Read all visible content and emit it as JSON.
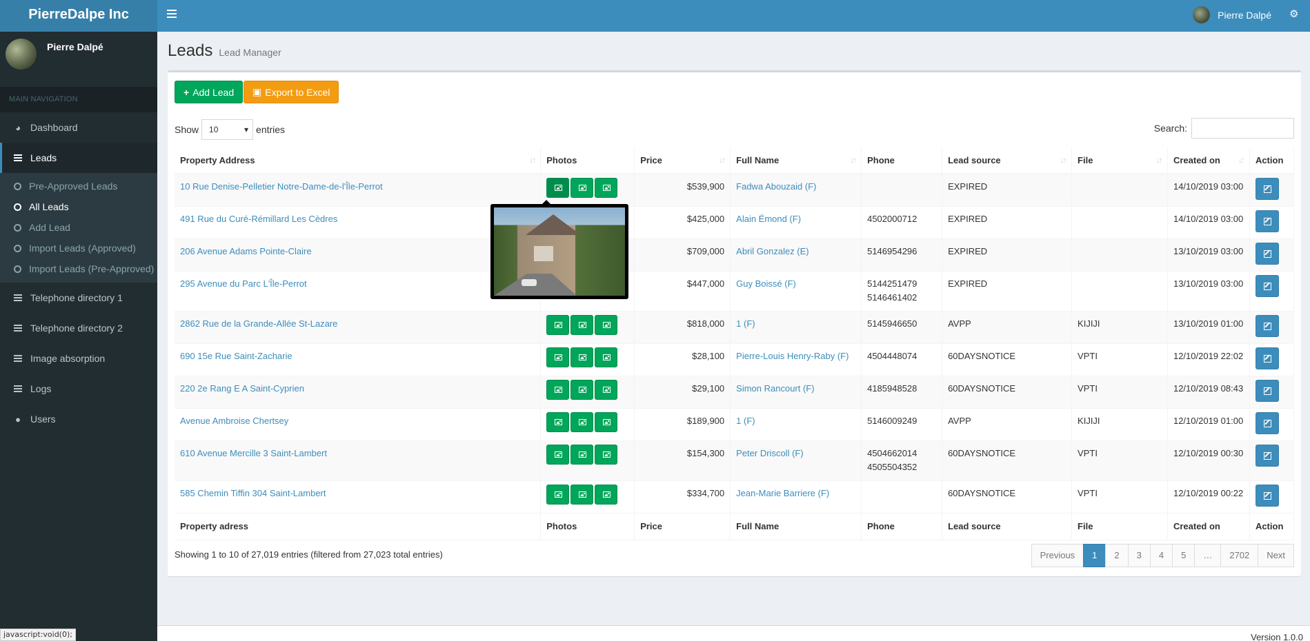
{
  "brand": "PierreDalpe Inc",
  "topbar": {
    "user_name": "Pierre Dalpé"
  },
  "sidebar": {
    "user_name": "Pierre Dalpé",
    "nav_header": "MAIN NAVIGATION",
    "items": [
      {
        "label": "Dashboard",
        "icon": "dashboard-icon"
      },
      {
        "label": "Leads",
        "icon": "menu-icon"
      },
      {
        "label": "Telephone directory 1",
        "icon": "menu-icon"
      },
      {
        "label": "Telephone directory 2",
        "icon": "menu-icon"
      },
      {
        "label": "Image absorption",
        "icon": "menu-icon"
      },
      {
        "label": "Logs",
        "icon": "menu-icon"
      },
      {
        "label": "Users",
        "icon": "user-icon"
      }
    ],
    "leads_sub": [
      {
        "label": "Pre-Approved Leads"
      },
      {
        "label": "All Leads"
      },
      {
        "label": "Add Lead"
      },
      {
        "label": "Import Leads (Approved)"
      },
      {
        "label": "Import Leads (Pre-Approved)"
      }
    ]
  },
  "page": {
    "title": "Leads",
    "subtitle": "Lead Manager"
  },
  "toolbar": {
    "add_label": "Add Lead",
    "export_label": "Export to Excel"
  },
  "table_controls": {
    "show_label": "Show",
    "entries_value": "10",
    "entries_label": "entries",
    "search_label": "Search:"
  },
  "columns": [
    "Property Address",
    "Photos",
    "Price",
    "Full Name",
    "Phone",
    "Lead source",
    "File",
    "Created on",
    "Action"
  ],
  "footer_columns": [
    "Property adress",
    "Photos",
    "Price",
    "Full Name",
    "Phone",
    "Lead source",
    "File",
    "Created on",
    "Action"
  ],
  "rows": [
    {
      "address": "10 Rue Denise-Pelletier Notre-Dame-de-l'Île-Perrot",
      "price": "$539,900",
      "name": "Fadwa Abouzaid (F)",
      "phone1": "",
      "phone2": "",
      "source": "EXPIRED",
      "file": "",
      "created": "14/10/2019 03:00"
    },
    {
      "address": "491 Rue du Curé-Rémillard Les Cèdres",
      "price": "$425,000",
      "name": "Alain Émond (F)",
      "phone1": "4502000712",
      "phone2": "",
      "source": "EXPIRED",
      "file": "",
      "created": "14/10/2019 03:00"
    },
    {
      "address": "206 Avenue Adams Pointe-Claire",
      "price": "$709,000",
      "name": "Abril Gonzalez (E)",
      "phone1": "5146954296",
      "phone2": "",
      "source": "EXPIRED",
      "file": "",
      "created": "13/10/2019 03:00"
    },
    {
      "address": "295 Avenue du Parc L'Île-Perrot",
      "price": "$447,000",
      "name": "Guy Boissé (F)",
      "phone1": "5144251479",
      "phone2": "5146461402",
      "source": "EXPIRED",
      "file": "",
      "created": "13/10/2019 03:00"
    },
    {
      "address": "2862 Rue de la Grande-Allée St-Lazare",
      "price": "$818,000",
      "name": "1 (F)",
      "phone1": "5145946650",
      "phone2": "",
      "source": "AVPP",
      "file": "KIJIJI",
      "created": "13/10/2019 01:00"
    },
    {
      "address": "690 15e Rue Saint-Zacharie",
      "price": "$28,100",
      "name": "Pierre-Louis Henry-Raby (F)",
      "phone1": "4504448074",
      "phone2": "",
      "source": "60DAYSNOTICE",
      "file": "VPTI",
      "created": "12/10/2019 22:02"
    },
    {
      "address": "220 2e Rang E A Saint-Cyprien",
      "price": "$29,100",
      "name": "Simon Rancourt (F)",
      "phone1": "4185948528",
      "phone2": "",
      "source": "60DAYSNOTICE",
      "file": "VPTI",
      "created": "12/10/2019 08:43"
    },
    {
      "address": "Avenue Ambroise Chertsey",
      "price": "$189,900",
      "name": "1 (F)",
      "phone1": "5146009249",
      "phone2": "",
      "source": "AVPP",
      "file": "KIJIJI",
      "created": "12/10/2019 01:00"
    },
    {
      "address": "610 Avenue Mercille 3 Saint-Lambert",
      "price": "$154,300",
      "name": "Peter Driscoll (F)",
      "phone1": "4504662014",
      "phone2": "4505504352",
      "source": "60DAYSNOTICE",
      "file": "VPTI",
      "created": "12/10/2019 00:30"
    },
    {
      "address": "585 Chemin Tiffin 304 Saint-Lambert",
      "price": "$334,700",
      "name": "Jean-Marie Barriere (F)",
      "phone1": "",
      "phone2": "",
      "source": "60DAYSNOTICE",
      "file": "VPTI",
      "created": "12/10/2019 00:22"
    }
  ],
  "info_text": "Showing 1 to 10 of 27,019 entries (filtered from 27,023 total entries)",
  "pagination": [
    "Previous",
    "1",
    "2",
    "3",
    "4",
    "5",
    "…",
    "2702",
    "Next"
  ],
  "status_url": "javascript:void(0);",
  "version": "Version 1.0.0"
}
